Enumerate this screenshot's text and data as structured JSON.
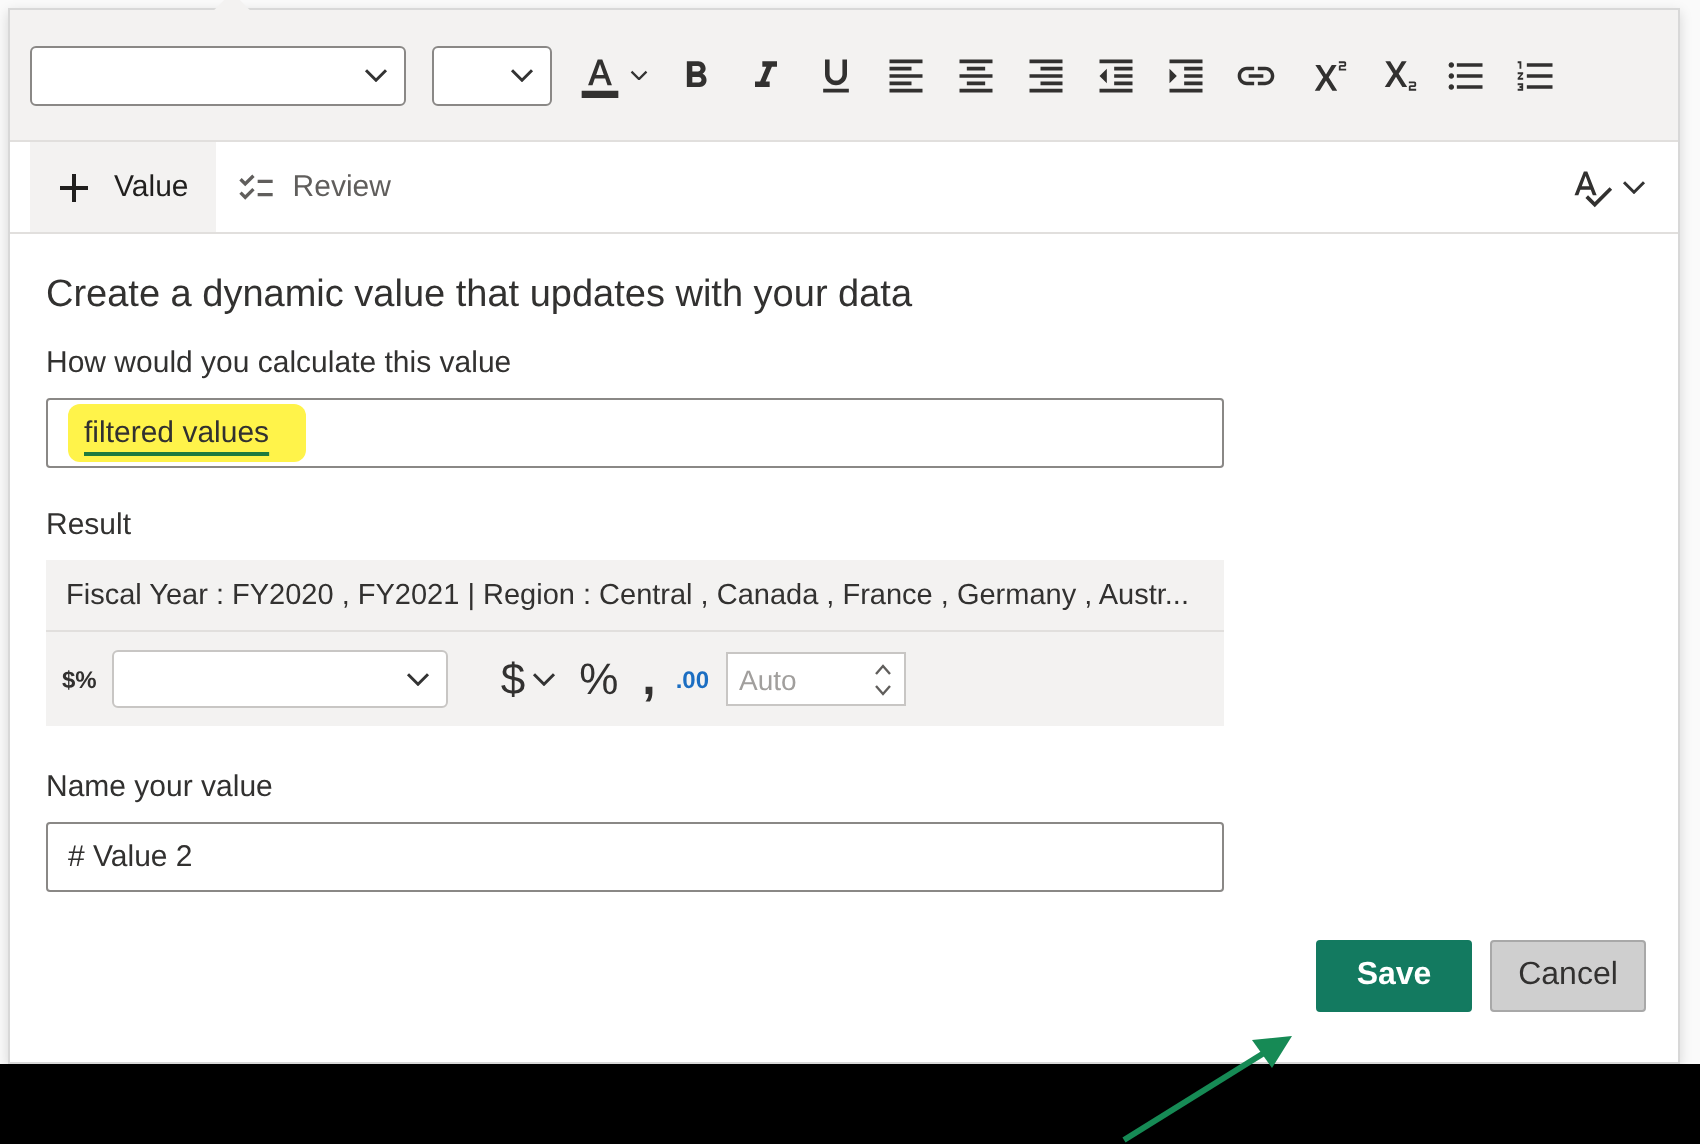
{
  "tabs": [
    {
      "label": "Value",
      "kind": "add",
      "selected": true
    },
    {
      "label": "Review",
      "kind": "review",
      "selected": false
    }
  ],
  "heading": "Create a dynamic value that updates with your data",
  "calculation": {
    "label": "How would you calculate this value",
    "value": "filtered values",
    "highlighted": true
  },
  "result": {
    "label": "Result",
    "text": "Fiscal Year : FY2020 , FY2021 | Region : Central , Canada , France , Germany , Austr...",
    "format_icon": "$%",
    "currency": "$",
    "percent": "%",
    "comma": ",",
    "decimal_icon": ".00",
    "decimal_placeholder": "Auto"
  },
  "name": {
    "label": "Name your value",
    "value": "# Value 2"
  },
  "buttons": [
    {
      "label": "Save",
      "kind": "primary"
    },
    {
      "label": "Cancel",
      "kind": "secondary"
    }
  ]
}
